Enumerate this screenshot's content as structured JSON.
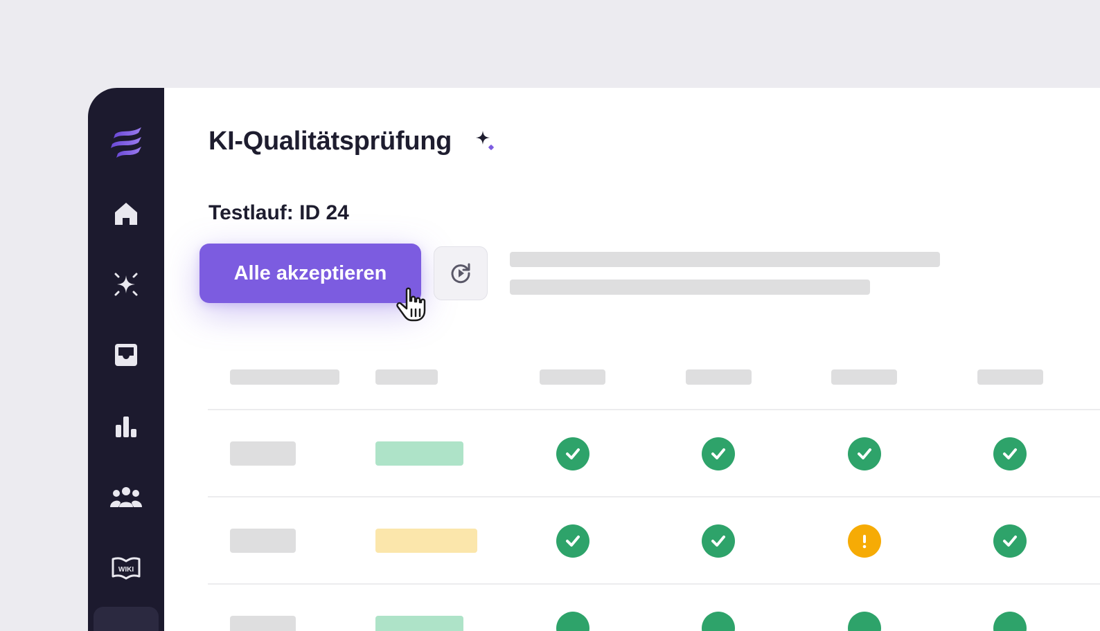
{
  "page": {
    "title": "KI-Qualitätsprüfung",
    "run_label": "Testlauf: ID 24"
  },
  "toolbar": {
    "accept_all_label": "Alle akzeptieren",
    "refresh_icon": "refresh-icon"
  },
  "sidebar": {
    "items": [
      {
        "icon": "logo-icon"
      },
      {
        "icon": "home-icon"
      },
      {
        "icon": "sparkle-icon"
      },
      {
        "icon": "inbox-icon"
      },
      {
        "icon": "bar-chart-icon"
      },
      {
        "icon": "team-icon"
      },
      {
        "icon": "wiki-icon",
        "label": "WIKI"
      }
    ]
  },
  "table": {
    "rows": [
      {
        "tag": "green",
        "checks": [
          "ok",
          "ok",
          "ok",
          "ok"
        ]
      },
      {
        "tag": "yellow",
        "checks": [
          "ok",
          "ok",
          "warn",
          "ok"
        ]
      },
      {
        "tag": "green",
        "checks": [
          "ok",
          "ok",
          "ok",
          "ok"
        ]
      }
    ]
  },
  "colors": {
    "accent": "#7c5ce0",
    "sidebar": "#1c1a2e",
    "success": "#2ea36a",
    "warning": "#f6ab05",
    "background": "#ecebf0"
  }
}
